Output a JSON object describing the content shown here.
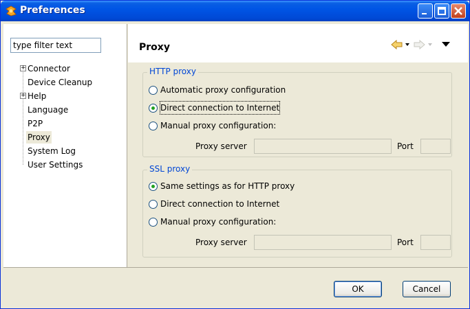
{
  "window": {
    "title": "Preferences"
  },
  "filter": {
    "value": "type filter text"
  },
  "tree": [
    {
      "label": "Connector",
      "expandable": true
    },
    {
      "label": "Device Cleanup",
      "expandable": false
    },
    {
      "label": "Help",
      "expandable": true
    },
    {
      "label": "Language",
      "expandable": false
    },
    {
      "label": "P2P",
      "expandable": false
    },
    {
      "label": "Proxy",
      "expandable": false,
      "selected": true
    },
    {
      "label": "System Log",
      "expandable": false
    },
    {
      "label": "User Settings",
      "expandable": false
    }
  ],
  "page": {
    "title": "Proxy"
  },
  "http": {
    "group_label": "HTTP proxy",
    "options": [
      {
        "label": "Automatic proxy configuration",
        "selected": false
      },
      {
        "label": "Direct connection to Internet",
        "selected": true
      },
      {
        "label": "Manual proxy configuration:",
        "selected": false
      }
    ],
    "server_label": "Proxy server",
    "server_value": "",
    "port_label": "Port",
    "port_value": ""
  },
  "ssl": {
    "group_label": "SSL proxy",
    "options": [
      {
        "label": "Same settings as for HTTP proxy",
        "selected": true
      },
      {
        "label": "Direct connection to Internet",
        "selected": false
      },
      {
        "label": "Manual proxy configuration:",
        "selected": false
      }
    ],
    "server_label": "Proxy server",
    "server_value": "",
    "port_label": "Port",
    "port_value": ""
  },
  "buttons": {
    "ok": "OK",
    "cancel": "Cancel"
  },
  "colors": {
    "title_bar": "#0055e5",
    "group_label": "#0046d5",
    "radio_dot": "#21a121"
  }
}
